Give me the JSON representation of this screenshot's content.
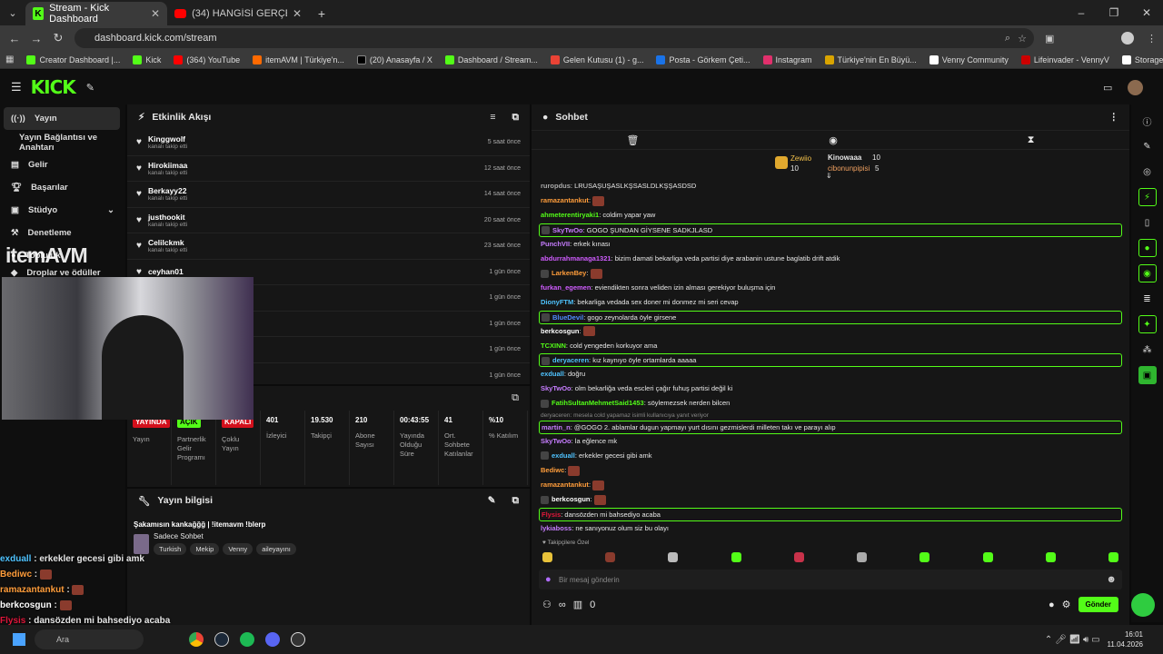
{
  "browser": {
    "tabs": [
      {
        "label": "Stream - Kick Dashboard",
        "active": true
      },
      {
        "label": "(34) HANGİSİ GERÇEK ESKİ SEV",
        "active": false
      }
    ],
    "new_tab": "+",
    "url": "dashboard.kick.com/stream",
    "bookmarks": [
      "Creator Dashboard |...",
      "Kick",
      "(364) YouTube",
      "itemAVM | Türkiye'n...",
      "(20) Anasayfa / X",
      "Dashboard / Stream...",
      "Gelen Kutusu (1) - g...",
      "Posta - Görkem Çeti...",
      "Instagram",
      "Türkiye'nin En Büyü...",
      "Venny Community",
      "Lifeinvader - VennyV",
      "Storage | Fivemanage"
    ]
  },
  "header": {
    "logo": "KICK"
  },
  "sidebar": {
    "items": [
      "Yayın",
      "Yayın Bağlantısı ve Anahtarı",
      "Gelir",
      "Başarılar",
      "Stüdyo",
      "Denetleme",
      "Topluluk",
      "Droplar ve ödüller"
    ]
  },
  "activity": {
    "title": "Etkinlik Akışı",
    "events": [
      {
        "name": "Kinggwolf",
        "sub": "kanalı takip etti",
        "time": "5 saat önce"
      },
      {
        "name": "Hirokiimaa",
        "sub": "kanalı takip etti",
        "time": "12 saat önce"
      },
      {
        "name": "Berkayy22",
        "sub": "kanalı takip etti",
        "time": "14 saat önce"
      },
      {
        "name": "justhookit",
        "sub": "kanalı takip etti",
        "time": "20 saat önce"
      },
      {
        "name": "Celilckmk",
        "sub": "kanalı takip etti",
        "time": "23 saat önce"
      },
      {
        "name": "ceyhan01",
        "sub": "",
        "time": "1 gün önce"
      },
      {
        "name": "",
        "sub": "",
        "time": "1 gün önce"
      },
      {
        "name": "",
        "sub": "",
        "time": "1 gün önce"
      },
      {
        "name": "",
        "sub": "",
        "time": "1 gün önce"
      },
      {
        "name": "",
        "sub": "",
        "time": "1 gün önce"
      }
    ]
  },
  "stats": [
    {
      "v": "YAYINDA",
      "l": "Yayın",
      "badge": "#d4101c"
    },
    {
      "v": "AÇIK",
      "l": "Partnerlik Gelir Programı",
      "badge": "#53fc18"
    },
    {
      "v": "KAPALI",
      "l": "Çoklu Yayın",
      "badge": "#d4101c"
    },
    {
      "v": "401",
      "l": "İzleyici"
    },
    {
      "v": "19.530",
      "l": "Takipçi"
    },
    {
      "v": "210",
      "l": "Abone Sayısı"
    },
    {
      "v": "00:43:55",
      "l": "Yayında Olduğu Süre"
    },
    {
      "v": "41",
      "l": "Ort. Sohbete Katılanlar"
    },
    {
      "v": "%10",
      "l": "% Katılım"
    }
  ],
  "stream_info": {
    "title": "Yayın bilgisi",
    "stream_title": "Şakamısın kankağğğ | !itemavm !blerp",
    "category": "Sadece Sohbet",
    "tags": [
      "Turkish",
      "Mekip",
      "Venny",
      "aileyayını"
    ]
  },
  "chat": {
    "title": "Sohbet",
    "leaders": [
      {
        "name": "Zewiio",
        "count": "10"
      },
      {
        "name": "Kinowaaa",
        "count": "10"
      },
      {
        "name": "cibonunpipisi",
        "count": "5"
      }
    ],
    "messages": [
      {
        "user": "ruropdus",
        "color": "#aaaaaa",
        "text": ": LRUSAŞUŞASLKŞSASLDLKŞŞASDSD",
        "hl": false
      },
      {
        "user": "ramazantankut",
        "color": "#ff9d3b",
        "text": ": ",
        "emote": true,
        "hl": false
      },
      {
        "user": "ahmeterentiryaki1",
        "color": "#53fc18",
        "text": ": coldim yapar yaw",
        "hl": false
      },
      {
        "user": "SkyTwOo",
        "color": "#c77dff",
        "text": ": GOGO ŞUNDAN GİYSENE SADKJLASD",
        "hl": true
      },
      {
        "user": "PunchVII",
        "color": "#c77dff",
        "text": ": erkek kınası",
        "hl": false
      },
      {
        "user": "abdurrahmanaga1321",
        "color": "#d05cff",
        "text": ": bizim damati bekarliga veda partisi diye arabanin ustune baglatib drift atdik",
        "hl": false
      },
      {
        "user": "LarkenBey",
        "color": "#ff9d3b",
        "text": ": ",
        "emote": true,
        "hl": false
      },
      {
        "user": "furkan_egemen",
        "color": "#d05cff",
        "text": ": eviendikten sonra veliden izin alması gerekiyor buluşma için",
        "hl": false
      },
      {
        "user": "DionyFTM",
        "color": "#4fc3ff",
        "text": ": bekarliga vedada sex doner mi donmez mi seri cevap",
        "hl": false
      },
      {
        "user": "BlueDevil",
        "color": "#4f8cff",
        "text": ": gogo zeynolarda öyle girsene",
        "hl": true
      },
      {
        "user": "berkcosgun",
        "color": "#ffffff",
        "text": ": ",
        "emote": true,
        "hl": false
      },
      {
        "user": "TCXINN",
        "color": "#53fc18",
        "text": ": cold yengeden korkuyor ama",
        "hl": false
      },
      {
        "user": "deryaceren",
        "color": "#4fc3ff",
        "text": ": kız kaynıyo öyle ortamlarda aaaaa",
        "hl": true
      },
      {
        "user": "exduall",
        "color": "#4fc3ff",
        "text": ": doğru",
        "hl": false
      },
      {
        "user": "SkyTwOo",
        "color": "#c77dff",
        "text": ": olm bekarliğa veda escleri çağır fuhuş partisi değil ki",
        "hl": false
      },
      {
        "user": "FatihSultanMehmetSaid1453",
        "color": "#53fc18",
        "text": ": söylemezsek nerden bilcen",
        "hl": false
      },
      {
        "user": "martin_n",
        "color": "#c77dff",
        "text": ": @GOGO 2. ablamlar dugun yapmayı yurt dısını gezmislerdi milleten takı ve parayı alıp",
        "hl": true
      },
      {
        "user": "SkyTwOo",
        "color": "#c77dff",
        "text": ": la eğlence mk",
        "hl": false
      },
      {
        "user": "exduall",
        "color": "#4fc3ff",
        "text": ": erkekler gecesi gibi amk",
        "hl": false
      },
      {
        "user": "Bediwc",
        "color": "#ff9d3b",
        "text": ": ",
        "emote": true,
        "hl": false
      },
      {
        "user": "ramazantankut",
        "color": "#ff9d3b",
        "text": ": ",
        "emote": true,
        "hl": false
      },
      {
        "user": "berkcosgun",
        "color": "#ffffff",
        "text": ": ",
        "emote": true,
        "hl": false
      },
      {
        "user": "Flysis",
        "color": "#e0163b",
        "text": ": dansözden mi bahsediyo acaba",
        "hl": true
      },
      {
        "user": "lykiaboss",
        "color": "#c77dff",
        "text": ": ne sanıyonuz olum siz bu olayı",
        "hl": false
      }
    ],
    "reply_note": "deryaceren: mesela cold yapamaz isimli kullanıcıya yanıt veriyor",
    "followers_label": "Takipçilere Özel",
    "input_placeholder": "Bir mesaj gönderin",
    "send": "Gönder",
    "points": "0"
  },
  "overlay": {
    "logo": "itemAVM",
    "lines": [
      {
        "user": "exduall",
        "text": " : erkekler gecesi gibi amk",
        "color": "#4fc3ff"
      },
      {
        "user": "Bediwc",
        "text": " : ",
        "color": "#ff9d3b"
      },
      {
        "user": "ramazantankut",
        "text": " : ",
        "color": "#ff9d3b"
      },
      {
        "user": "berkcosgun",
        "text": " : ",
        "color": "#ffffff"
      },
      {
        "user": "Flysis",
        "text": " : dansözden mi bahsediyo acaba",
        "color": "#e0163b"
      },
      {
        "user": "lykiaboss",
        "text": " : ne sanıyonuz olum siz bu olayı",
        "color": "#c77dff"
      }
    ]
  },
  "taskbar": {
    "search": "Ara",
    "time": "16:01",
    "date": "11.04.2026"
  }
}
